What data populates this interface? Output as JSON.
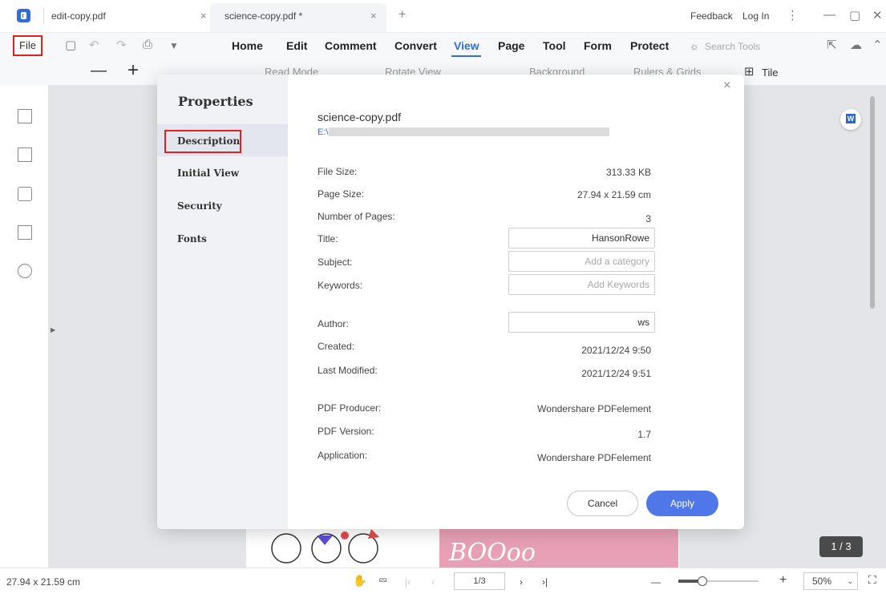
{
  "tabs": [
    {
      "label": "edit-copy.pdf",
      "close": "×"
    },
    {
      "label": "science-copy.pdf *",
      "close": "×"
    }
  ],
  "new_tab": "+",
  "titlebar_right": {
    "feedback": "Feedback",
    "login": "Log In",
    "more": "⋮",
    "minimize": "—",
    "maximize": "▢",
    "close": "✕"
  },
  "menu": {
    "file": "File",
    "items": [
      "Home",
      "Edit",
      "Comment",
      "Convert",
      "View",
      "Page",
      "Tool",
      "Form",
      "Protect"
    ],
    "search_tools": "Search Tools"
  },
  "subtoolbar": {
    "zoom_out": "—",
    "zoom_in": "+",
    "read_mode": "Read Mode",
    "rotate_view": "Rotate View",
    "background": "Background",
    "rulers_grids": "Rulers & Grids",
    "tile": "Tile"
  },
  "dialog": {
    "title": "Properties",
    "nav": [
      "Description",
      "Initial View",
      "Security",
      "Fonts"
    ],
    "active_nav": "Description",
    "file_name": "science-copy.pdf",
    "file_path": "E:\\",
    "rows": {
      "file_size": {
        "label": "File Size:",
        "value": "313.33 KB"
      },
      "page_size": {
        "label": "Page Size:",
        "value": "27.94 x 21.59 cm"
      },
      "num_pages": {
        "label": "Number of Pages:",
        "value": "3"
      },
      "title": {
        "label": "Title:",
        "value": "HansonRowe"
      },
      "subject": {
        "label": "Subject:",
        "placeholder": "Add a category"
      },
      "keywords": {
        "label": "Keywords:",
        "placeholder": "Add Keywords"
      },
      "author": {
        "label": "Author:",
        "value": "ws"
      },
      "created": {
        "label": "Created:",
        "value": "2021/12/24 9:50"
      },
      "modified": {
        "label": "Last Modified:",
        "value": "2021/12/24 9:51"
      },
      "producer": {
        "label": "PDF Producer:",
        "value": "Wondershare PDFelement"
      },
      "version": {
        "label": "PDF Version:",
        "value": "1.7"
      },
      "application": {
        "label": "Application:",
        "value": "Wondershare PDFelement"
      }
    },
    "cancel": "Cancel",
    "apply": "Apply",
    "close": "×"
  },
  "page_content_text": "BOOoo",
  "page_badge": "1 / 3",
  "status": {
    "page_size": "27.94 x 21.59 cm",
    "page_field": "1/3",
    "zoom": "50%"
  },
  "colors": {
    "accent": "#2f6ddb",
    "apply": "#4f77e8",
    "highlight_box": "#dd2222"
  }
}
